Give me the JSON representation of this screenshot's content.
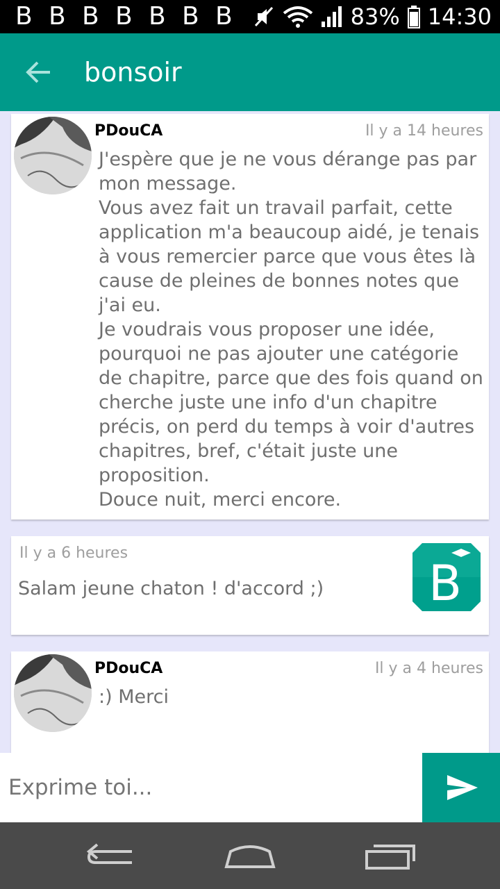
{
  "status_bar": {
    "battery": "83%",
    "time": "14:30",
    "notification_glyph": "B"
  },
  "app_bar": {
    "title": "bonsoir"
  },
  "messages": [
    {
      "author": "PDouCA",
      "time": "Il y a 14 heures",
      "text": "J'espère que je ne vous dérange pas par mon message.\nVous avez fait un travail parfait, cette application m'a beaucoup aidé, je tenais à vous remercier parce que vous êtes là cause de pleines de bonnes notes que j'ai eu.\nJe voudrais vous proposer une idée, pourquoi ne pas ajouter une catégorie de chapitre, parce que des fois quand on cherche juste une info d'un chapitre précis, on perd du temps à voir d'autres chapitres, bref, c'était juste une proposition.\nDouce nuit, merci encore."
    },
    {
      "time": "Il y a 6 heures",
      "text": "Salam jeune chaton ! d'accord ;)",
      "logo_letter": "B"
    },
    {
      "author": "PDouCA",
      "time": "Il y a 4 heures",
      "text": ":) Merci"
    }
  ],
  "composer": {
    "placeholder": "Exprime toi..."
  },
  "colors": {
    "primary": "#009a8a",
    "background": "#e6e6fa",
    "nav_bar": "#4a4a4a"
  }
}
